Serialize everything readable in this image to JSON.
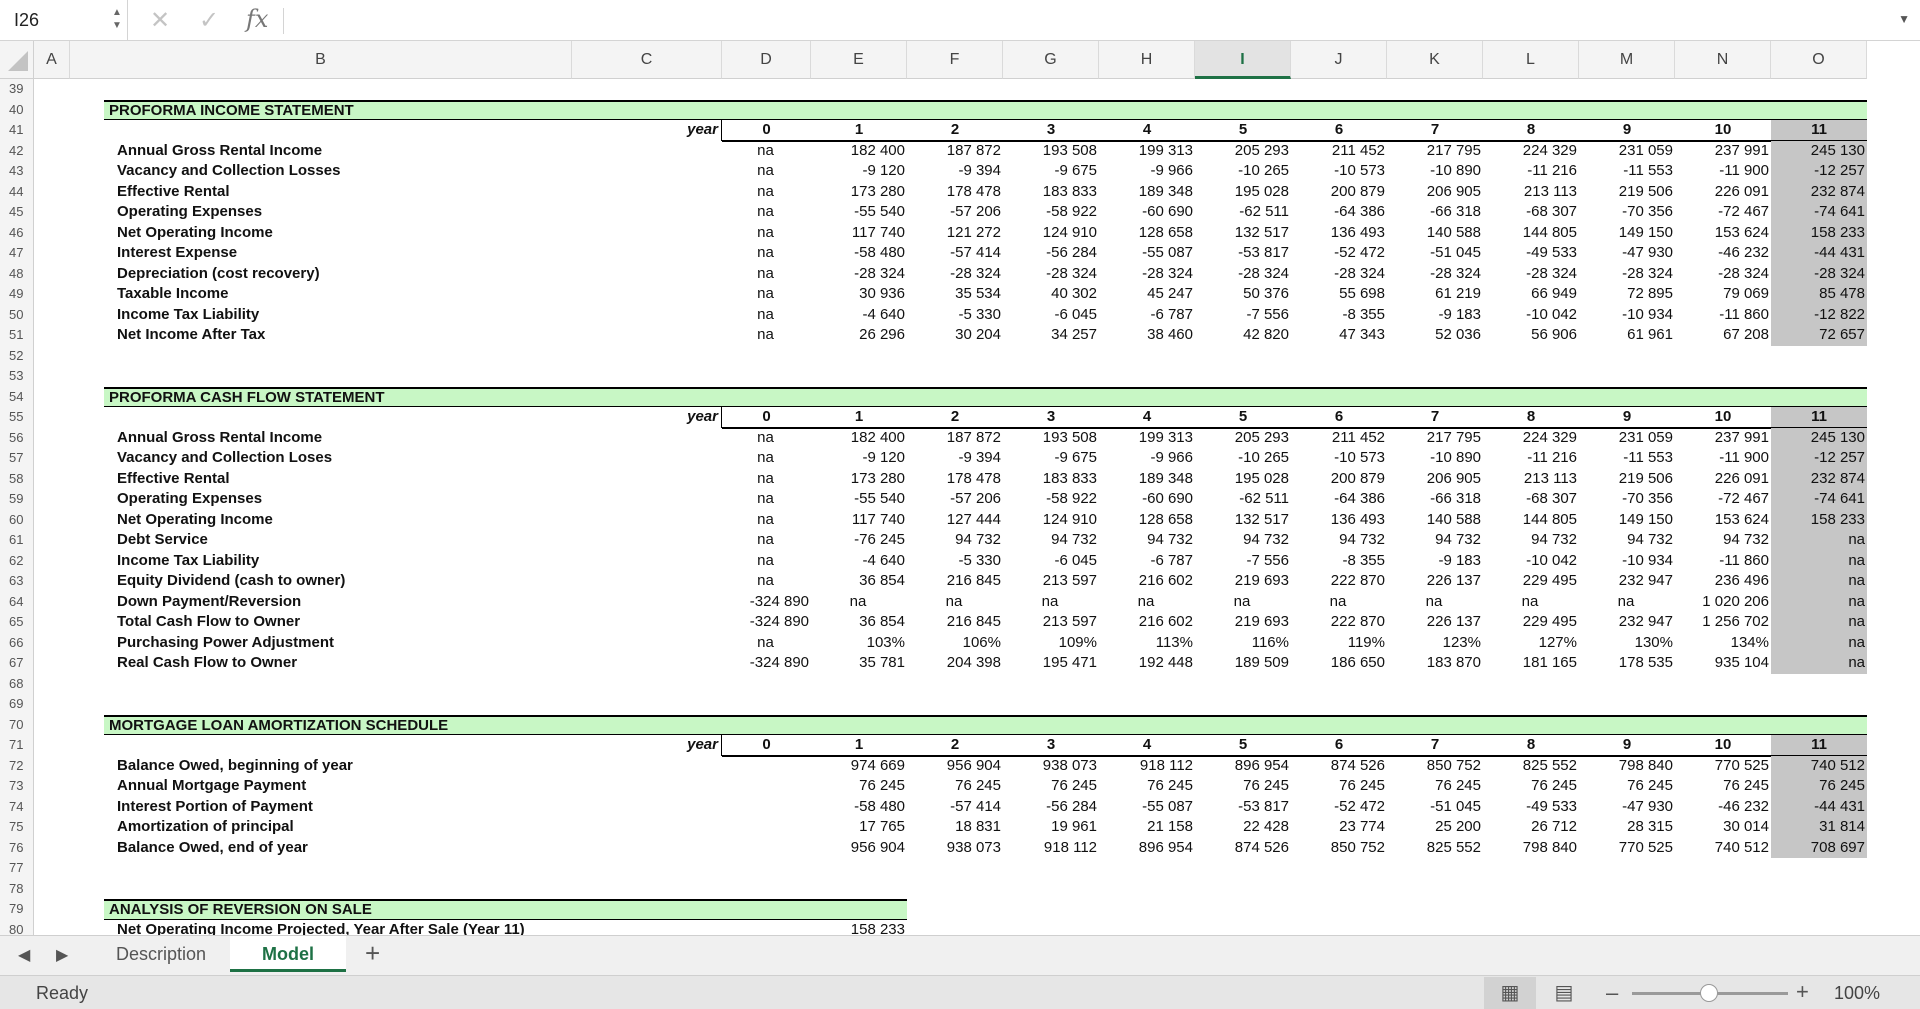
{
  "formula_bar": {
    "name_box": "I26",
    "formula": "",
    "icons": [
      "cancel-icon",
      "enter-icon",
      "fx-icon"
    ],
    "fx_label": "fx"
  },
  "columns": [
    {
      "name": "A",
      "w": 36
    },
    {
      "name": "B",
      "w": 536
    },
    {
      "name": "C",
      "w": 0
    },
    {
      "name": "D",
      "w": 0
    },
    {
      "name": "E",
      "w": 0
    }
  ],
  "column_headers": [
    "A",
    "B",
    "C",
    "D",
    "E",
    "F",
    "G",
    "H",
    "I",
    "J",
    "K",
    "L",
    "M",
    "N",
    "O"
  ],
  "active_column": "I",
  "row_numbers": [
    "39",
    "40",
    "41",
    "42",
    "43",
    "44",
    "45",
    "46",
    "47",
    "48",
    "49",
    "50",
    "51",
    "52",
    "53",
    "54",
    "55",
    "56",
    "57",
    "58",
    "59",
    "60",
    "61",
    "62",
    "63",
    "64",
    "65",
    "66",
    "67",
    "68",
    "69",
    "70",
    "71",
    "72",
    "73",
    "74",
    "75",
    "76",
    "77",
    "78",
    "79",
    "80"
  ],
  "year_label": "year",
  "years": [
    "0",
    "1",
    "2",
    "3",
    "4",
    "5",
    "6",
    "7",
    "8",
    "9",
    "10",
    "11"
  ],
  "income_statement": {
    "title": "PROFORMA INCOME STATEMENT",
    "rows": [
      {
        "label": "Annual Gross Rental Income",
        "values": [
          "na",
          "182 400",
          "187 872",
          "193 508",
          "199 313",
          "205 293",
          "211 452",
          "217 795",
          "224 329",
          "231 059",
          "237 991",
          "245 130"
        ]
      },
      {
        "label": "Vacancy and Collection Losses",
        "values": [
          "na",
          "-9 120",
          "-9 394",
          "-9 675",
          "-9 966",
          "-10 265",
          "-10 573",
          "-10 890",
          "-11 216",
          "-11 553",
          "-11 900",
          "-12 257"
        ]
      },
      {
        "label": "Effective Rental",
        "values": [
          "na",
          "173 280",
          "178 478",
          "183 833",
          "189 348",
          "195 028",
          "200 879",
          "206 905",
          "213 113",
          "219 506",
          "226 091",
          "232 874"
        ]
      },
      {
        "label": "Operating Expenses",
        "values": [
          "na",
          "-55 540",
          "-57 206",
          "-58 922",
          "-60 690",
          "-62 511",
          "-64 386",
          "-66 318",
          "-68 307",
          "-70 356",
          "-72 467",
          "-74 641"
        ]
      },
      {
        "label": "Net Operating Income",
        "values": [
          "na",
          "117 740",
          "121 272",
          "124 910",
          "128 658",
          "132 517",
          "136 493",
          "140 588",
          "144 805",
          "149 150",
          "153 624",
          "158 233"
        ]
      },
      {
        "label": "Interest Expense",
        "values": [
          "na",
          "-58 480",
          "-57 414",
          "-56 284",
          "-55 087",
          "-53 817",
          "-52 472",
          "-51 045",
          "-49 533",
          "-47 930",
          "-46 232",
          "-44 431"
        ]
      },
      {
        "label": "Depreciation (cost recovery)",
        "values": [
          "na",
          "-28 324",
          "-28 324",
          "-28 324",
          "-28 324",
          "-28 324",
          "-28 324",
          "-28 324",
          "-28 324",
          "-28 324",
          "-28 324",
          "-28 324"
        ]
      },
      {
        "label": "Taxable Income",
        "values": [
          "na",
          "30 936",
          "35 534",
          "40 302",
          "45 247",
          "50 376",
          "55 698",
          "61 219",
          "66 949",
          "72 895",
          "79 069",
          "85 478"
        ]
      },
      {
        "label": "Income Tax Liability",
        "values": [
          "na",
          "-4 640",
          "-5 330",
          "-6 045",
          "-6 787",
          "-7 556",
          "-8 355",
          "-9 183",
          "-10 042",
          "-10 934",
          "-11 860",
          "-12 822"
        ]
      },
      {
        "label": "Net Income After Tax",
        "values": [
          "na",
          "26 296",
          "30 204",
          "34 257",
          "38 460",
          "42 820",
          "47 343",
          "52 036",
          "56 906",
          "61 961",
          "67 208",
          "72 657"
        ]
      }
    ]
  },
  "cash_flow_statement": {
    "title": "PROFORMA CASH FLOW STATEMENT",
    "rows": [
      {
        "label": "Annual Gross Rental Income",
        "values": [
          "na",
          "182 400",
          "187 872",
          "193 508",
          "199 313",
          "205 293",
          "211 452",
          "217 795",
          "224 329",
          "231 059",
          "237 991",
          "245 130"
        ]
      },
      {
        "label": "Vacancy and Collection Loses",
        "values": [
          "na",
          "-9 120",
          "-9 394",
          "-9 675",
          "-9 966",
          "-10 265",
          "-10 573",
          "-10 890",
          "-11 216",
          "-11 553",
          "-11 900",
          "-12 257"
        ]
      },
      {
        "label": "Effective Rental",
        "values": [
          "na",
          "173 280",
          "178 478",
          "183 833",
          "189 348",
          "195 028",
          "200 879",
          "206 905",
          "213 113",
          "219 506",
          "226 091",
          "232 874"
        ]
      },
      {
        "label": "Operating Expenses",
        "values": [
          "na",
          "-55 540",
          "-57 206",
          "-58 922",
          "-60 690",
          "-62 511",
          "-64 386",
          "-66 318",
          "-68 307",
          "-70 356",
          "-72 467",
          "-74 641"
        ]
      },
      {
        "label": "Net Operating Income",
        "values": [
          "na",
          "117 740",
          "127 444",
          "124 910",
          "128 658",
          "132 517",
          "136 493",
          "140 588",
          "144 805",
          "149 150",
          "153 624",
          "158 233"
        ]
      },
      {
        "label": "Debt Service",
        "values": [
          "na",
          "-76 245",
          "94 732",
          "94 732",
          "94 732",
          "94 732",
          "94 732",
          "94 732",
          "94 732",
          "94 732",
          "94 732",
          "na"
        ]
      },
      {
        "label": "Income Tax Liability",
        "values": [
          "na",
          "-4 640",
          "-5 330",
          "-6 045",
          "-6 787",
          "-7 556",
          "-8 355",
          "-9 183",
          "-10 042",
          "-10 934",
          "-11 860",
          "na"
        ]
      },
      {
        "label": "Equity Dividend (cash to owner)",
        "values": [
          "na",
          "36 854",
          "216 845",
          "213 597",
          "216 602",
          "219 693",
          "222 870",
          "226 137",
          "229 495",
          "232 947",
          "236 496",
          "na"
        ]
      },
      {
        "label": "Down Payment/Reversion",
        "values": [
          "-324 890",
          "na",
          "na",
          "na",
          "na",
          "na",
          "na",
          "na",
          "na",
          "na",
          "1 020 206",
          "na"
        ]
      },
      {
        "label": "Total Cash Flow to Owner",
        "values": [
          "-324 890",
          "36 854",
          "216 845",
          "213 597",
          "216 602",
          "219 693",
          "222 870",
          "226 137",
          "229 495",
          "232 947",
          "1 256 702",
          "na"
        ]
      },
      {
        "label": "Purchasing Power Adjustment",
        "values": [
          "na",
          "103%",
          "106%",
          "109%",
          "113%",
          "116%",
          "119%",
          "123%",
          "127%",
          "130%",
          "134%",
          "na"
        ]
      },
      {
        "label": "Real Cash Flow to Owner",
        "values": [
          "-324 890",
          "35 781",
          "204 398",
          "195 471",
          "192 448",
          "189 509",
          "186 650",
          "183 870",
          "181 165",
          "178 535",
          "935 104",
          "na"
        ]
      }
    ]
  },
  "mortgage_schedule": {
    "title": "MORTGAGE LOAN AMORTIZATION SCHEDULE",
    "rows": [
      {
        "label": "Balance Owed, beginning of year",
        "values": [
          "",
          "974 669",
          "956 904",
          "938 073",
          "918 112",
          "896 954",
          "874 526",
          "850 752",
          "825 552",
          "798 840",
          "770 525",
          "740 512"
        ]
      },
      {
        "label": "Annual Mortgage Payment",
        "values": [
          "",
          "76 245",
          "76 245",
          "76 245",
          "76 245",
          "76 245",
          "76 245",
          "76 245",
          "76 245",
          "76 245",
          "76 245",
          "76 245"
        ]
      },
      {
        "label": "Interest Portion of Payment",
        "values": [
          "",
          "-58 480",
          "-57 414",
          "-56 284",
          "-55 087",
          "-53 817",
          "-52 472",
          "-51 045",
          "-49 533",
          "-47 930",
          "-46 232",
          "-44 431"
        ]
      },
      {
        "label": "Amortization of principal",
        "values": [
          "",
          "17 765",
          "18 831",
          "19 961",
          "21 158",
          "22 428",
          "23 774",
          "25 200",
          "26 712",
          "28 315",
          "30 014",
          "31 814"
        ]
      },
      {
        "label": "Balance Owed, end of year",
        "values": [
          "",
          "956 904",
          "938 073",
          "918 112",
          "896 954",
          "874 526",
          "850 752",
          "825 552",
          "798 840",
          "770 525",
          "740 512",
          "708 697"
        ]
      }
    ]
  },
  "reversion_analysis": {
    "title": "ANALYSIS OF REVERSION ON SALE",
    "first_row_label": "Net Operating Income Projected, Year After Sale (Year 11)",
    "first_row_value": "158 233"
  },
  "sheet_tabs": [
    {
      "label": "Description",
      "active": false
    },
    {
      "label": "Model",
      "active": true
    }
  ],
  "add_sheet_label": "+",
  "status": {
    "ready": "Ready",
    "zoom": "100%",
    "zoom_percent": 100
  },
  "colors": {
    "section_fill": "#c8f7c5",
    "accent_green": "#1e7145",
    "highlight_gray": "#c6c6c6"
  }
}
